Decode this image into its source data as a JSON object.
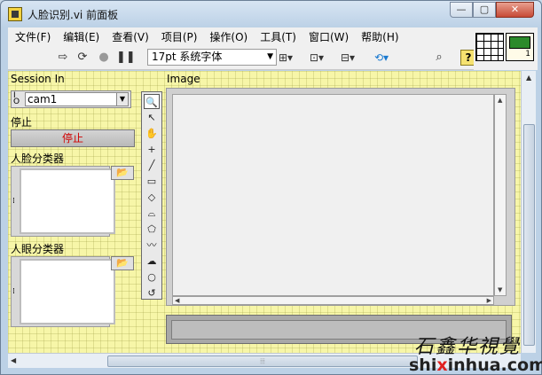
{
  "window": {
    "title": "人脸识别.vi 前面板",
    "buttons": {
      "minimize": "—",
      "maximize": "▢",
      "close": "✕"
    }
  },
  "menu": [
    "文件(F)",
    "编辑(E)",
    "查看(V)",
    "项目(P)",
    "操作(O)",
    "工具(T)",
    "窗口(W)",
    "帮助(H)"
  ],
  "toolbar": {
    "font": "17pt 系统字体",
    "help": "?",
    "icons": [
      "run-arrow-icon",
      "run-continuous-icon",
      "abort-icon",
      "pause-icon",
      "align-icon",
      "distribute-icon",
      "resize-icon",
      "reorder-icon",
      "search-icon",
      "help-icon"
    ]
  },
  "connector": {
    "vi_number": "1"
  },
  "panel": {
    "session_label": "Session In",
    "session_value": "cam1",
    "stop_label": "停止",
    "stop_button": "停止",
    "face_classifier_label": "人脸分类器",
    "eye_classifier_label": "人眼分类器",
    "image_label": "Image"
  },
  "tools": [
    "🔍",
    "↖",
    "✋",
    "+",
    "╱",
    "▭",
    "◇",
    "⌓",
    "⬠",
    "〰",
    "☁",
    "○",
    "↺"
  ],
  "watermark": {
    "brand": "石鑫华視覺",
    "url_pre": "shi",
    "url_x": "x",
    "url_post": "inhua.com"
  },
  "colors": {
    "panel_bg": "#f7f6a8",
    "stop_text": "#d00000",
    "window": "#bcd1e6"
  }
}
